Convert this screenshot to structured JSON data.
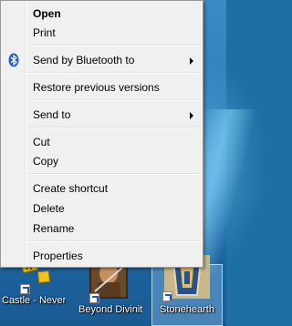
{
  "context_menu": {
    "items": [
      {
        "label": "Open",
        "bold": true
      },
      {
        "label": "Print"
      },
      {
        "label": "Send by Bluetooth to",
        "icon": "bluetooth-icon",
        "submenu": true
      },
      {
        "label": "Restore previous versions"
      },
      {
        "label": "Send to",
        "submenu": true
      },
      {
        "label": "Cut"
      },
      {
        "label": "Copy"
      },
      {
        "label": "Create shortcut"
      },
      {
        "label": "Delete"
      },
      {
        "label": "Rename"
      },
      {
        "label": "Properties"
      }
    ]
  },
  "desktop": {
    "icons": [
      {
        "caption": "Castle - Never Jud...",
        "icon": "game-icon-castle"
      },
      {
        "caption": "Beyond Divinity",
        "icon": "game-icon-beyond-divinity"
      },
      {
        "caption": "Stonehearth",
        "icon": "game-icon-stonehearth",
        "selected": true
      }
    ]
  },
  "colors": {
    "menu_bg": "#f0f0f0",
    "menu_border": "#979797",
    "bluetooth": "#1f5fd6",
    "desktop_bg": "#2a7ab8"
  }
}
